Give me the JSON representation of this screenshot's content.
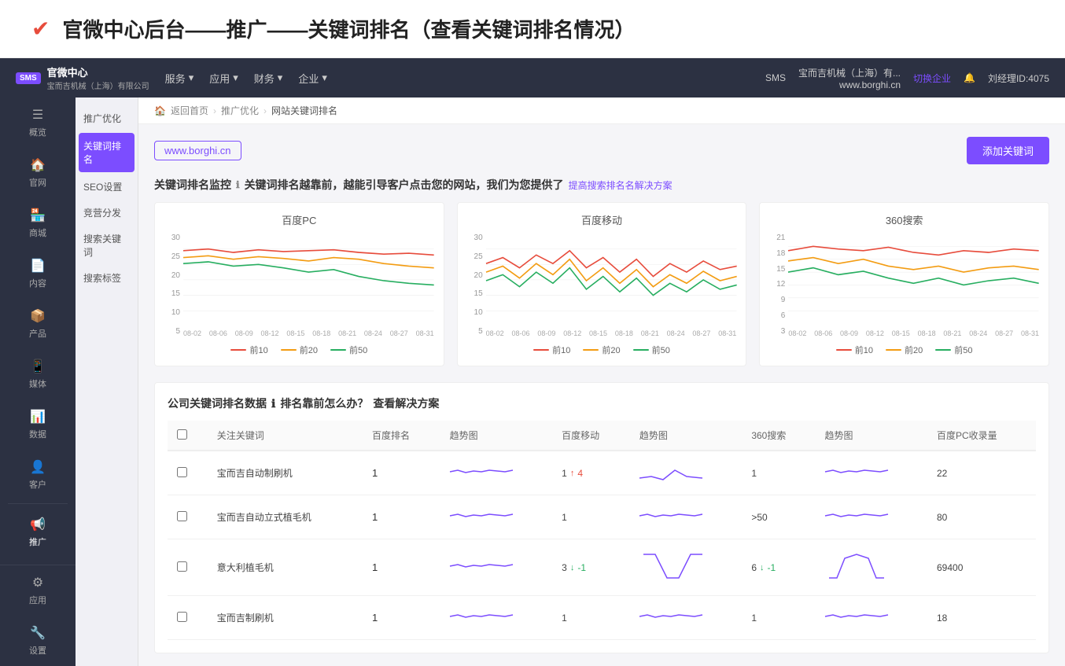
{
  "title": "官微中心后台——推广——关键词排名（查看关键词排名情况）",
  "header": {
    "logo_icon": "SMS",
    "company_name": "官微中心",
    "company_sub": "宝而吉机械（上海）有限公司",
    "nav_items": [
      "服务",
      "应用",
      "财务",
      "企业"
    ],
    "right_company": "宝而吉机械（上海）有...",
    "right_url": "www.borghi.cn",
    "switch_label": "切换企业",
    "user_label": "刘经理ID:4075"
  },
  "sidebar": {
    "items": [
      {
        "icon": "☰",
        "label": "概览"
      },
      {
        "icon": "🏠",
        "label": "官网"
      },
      {
        "icon": "🏪",
        "label": "商城"
      },
      {
        "icon": "📄",
        "label": "内容"
      },
      {
        "icon": "📦",
        "label": "产品"
      },
      {
        "icon": "📱",
        "label": "媒体"
      },
      {
        "icon": "📊",
        "label": "数据"
      },
      {
        "icon": "👤",
        "label": "客户"
      },
      {
        "icon": "📢",
        "label": "推广"
      }
    ],
    "bottom_items": [
      {
        "icon": "⚙",
        "label": "应用"
      },
      {
        "icon": "🔧",
        "label": "设置"
      }
    ]
  },
  "sub_sidebar": {
    "items": [
      {
        "label": "推广优化",
        "active": false
      },
      {
        "label": "关键词排名",
        "active": true
      },
      {
        "label": "SEO设置",
        "active": false
      },
      {
        "label": "竞营分发",
        "active": false
      },
      {
        "label": "搜索关键词",
        "active": false
      },
      {
        "label": "搜索标签",
        "active": false
      }
    ]
  },
  "breadcrumb": {
    "home": "返回首页",
    "level1": "推广优化",
    "level2": "网站关键词排名"
  },
  "domain": "www.borghi.cn",
  "add_keyword_btn": "添加关键词",
  "monitoring_title": "关键词排名监控",
  "monitoring_desc": "关键词排名越靠前，越能引导客户点击您的网站，我们为您提供了",
  "monitoring_link": "提高搜索排名名解决方案",
  "charts": [
    {
      "title": "百度PC",
      "y_labels": [
        "30",
        "25",
        "20",
        "15",
        "10",
        "5"
      ],
      "x_labels": [
        "08-02",
        "08-06",
        "08-09",
        "08-12",
        "08-15",
        "08-18",
        "08-21",
        "08-24",
        "08-27",
        "08-31"
      ]
    },
    {
      "title": "百度移动",
      "y_labels": [
        "30",
        "25",
        "20",
        "15",
        "10",
        "5"
      ],
      "x_labels": [
        "08-02",
        "08-06",
        "08-09",
        "08-12",
        "08-15",
        "08-18",
        "08-21",
        "08-24",
        "08-27",
        "08-31"
      ]
    },
    {
      "title": "360搜索",
      "y_labels": [
        "21",
        "18",
        "15",
        "12",
        "9",
        "6",
        "3"
      ],
      "x_labels": [
        "08-02",
        "08-06",
        "08-09",
        "08-12",
        "08-15",
        "08-18",
        "08-21",
        "08-24",
        "08-27",
        "08-31"
      ]
    }
  ],
  "chart_legend": [
    {
      "label": "前10",
      "color": "#e74c3c"
    },
    {
      "label": "前20",
      "color": "#f39c12"
    },
    {
      "label": "前50",
      "color": "#27ae60"
    }
  ],
  "table_title": "公司关键词排名数据",
  "table_desc": "排名靠前怎么办？",
  "table_link": "查看解决方案",
  "table_headers": [
    "关注关键词",
    "百度排名",
    "趋势图",
    "百度移动",
    "趋势图",
    "360搜索",
    "趋势图",
    "百度PC收录量"
  ],
  "table_rows": [
    {
      "keyword": "宝而吉自动制刷机",
      "baidu_rank": "1",
      "baidu_mobile": "1",
      "baidu_mobile_change": "4",
      "baidu_mobile_arrow": "up",
      "seo360": "1",
      "pc_collect": "22",
      "has_v_shape": false
    },
    {
      "keyword": "宝而吉自动立式植毛机",
      "baidu_rank": "1",
      "baidu_mobile": "1",
      "baidu_mobile_change": "",
      "baidu_mobile_arrow": "none",
      "seo360": ">50",
      "pc_collect": "80",
      "has_v_shape": false
    },
    {
      "keyword": "意大利植毛机",
      "baidu_rank": "1",
      "baidu_mobile": "3",
      "baidu_mobile_change": "-1",
      "baidu_mobile_arrow": "down",
      "seo360": "6",
      "pc_collect": "69400",
      "has_v_shape": true
    },
    {
      "keyword": "宝而吉制刷机",
      "baidu_rank": "1",
      "baidu_mobile": "1",
      "baidu_mobile_change": "",
      "baidu_mobile_arrow": "none",
      "seo360": "1",
      "pc_collect": "18",
      "has_v_shape": false
    }
  ]
}
